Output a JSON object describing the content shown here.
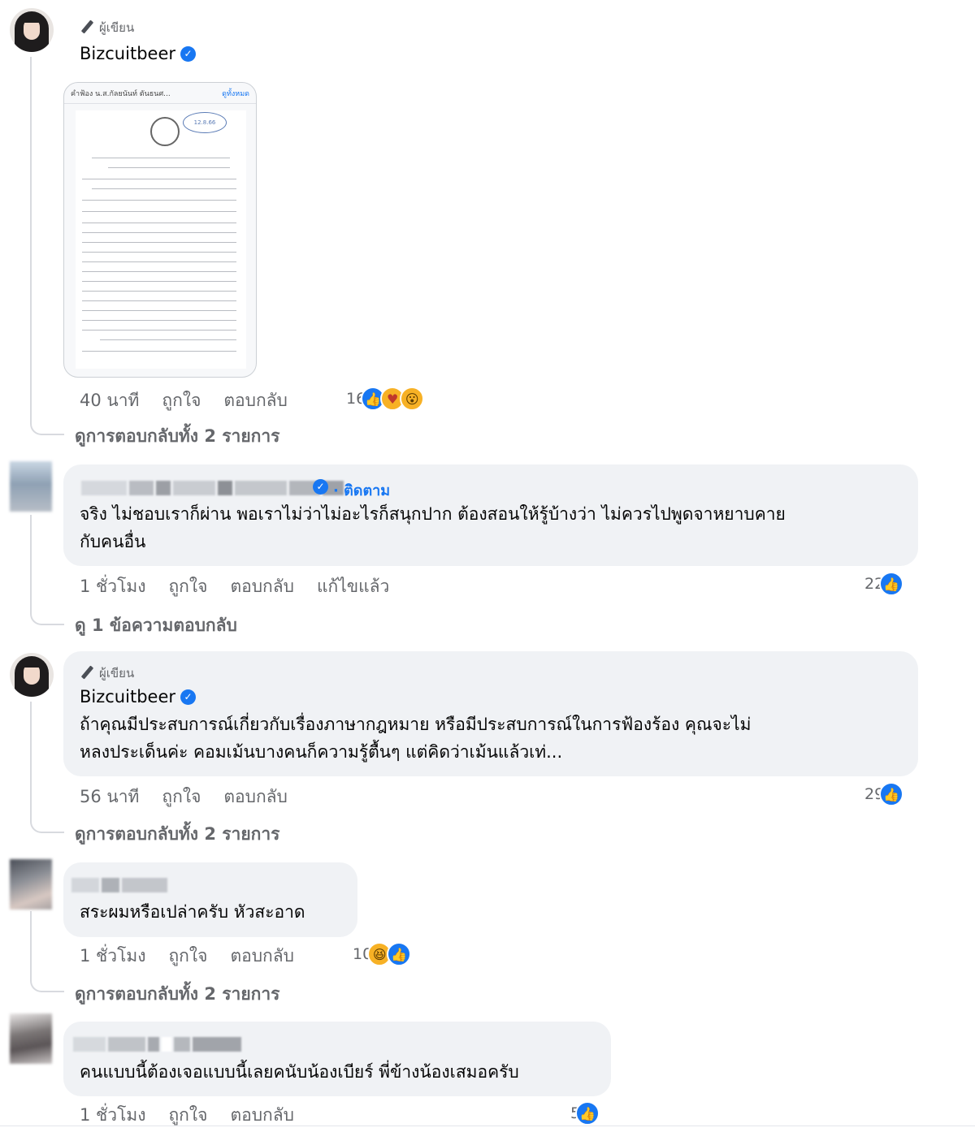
{
  "comments": [
    {
      "badge": "ผู้เขียน",
      "name": "Bizcuitbeer",
      "verified": true,
      "attachment": {
        "header": "คำฟ้อง น.ส.กัลยนันท์ ตันธนศ...",
        "header_action": "ดูทั้งหมด",
        "stamp": "12.8.66"
      },
      "time": "40 นาที",
      "like": "ถูกใจ",
      "reply": "ตอบกลับ",
      "reaction_count": "16",
      "reaction_icons": [
        "like-icon",
        "care-icon",
        "wow-icon"
      ],
      "view_replies": "ดูการตอบกลับทั้ง 2 รายการ"
    },
    {
      "name_blurred": true,
      "verified": true,
      "follow": "· ติดตาม",
      "text_line1": "จริง ไม่ชอบเราก็ผ่าน พอเราไม่ว่าไม่อะไรก็สนุกปาก ต้องสอนให้รู้บ้างว่า ไม่ควรไปพูดจาหยาบคาย",
      "text_line2": "กับคนอื่น",
      "time": "1 ชั่วโมง",
      "like": "ถูกใจ",
      "reply": "ตอบกลับ",
      "edited": "แก้ไขแล้ว",
      "reaction_count": "22",
      "reaction_icons": [
        "like-icon"
      ],
      "view_replies": "ดู 1 ข้อความตอบกลับ"
    },
    {
      "badge": "ผู้เขียน",
      "name": "Bizcuitbeer",
      "verified": true,
      "text_line1": "ถ้าคุณมีประสบการณ์เกี่ยวกับเรื่องภาษากฎหมาย หรือมีประสบการณ์ในการฟ้องร้อง คุณจะไม่",
      "text_line2": "หลงประเด็นค่ะ คอมเม้นบางคนก็ความรู้ตื้นๆ แต่คิดว่าเม้นแล้วเท่...",
      "time": "56 นาที",
      "like": "ถูกใจ",
      "reply": "ตอบกลับ",
      "reaction_count": "29",
      "reaction_icons": [
        "like-icon"
      ],
      "view_replies": "ดูการตอบกลับทั้ง 2 รายการ"
    },
    {
      "name_blurred": true,
      "text_line1": "สระผมหรือเปล่าครับ หัวสะอาด",
      "time": "1 ชั่วโมง",
      "like": "ถูกใจ",
      "reply": "ตอบกลับ",
      "reaction_count": "10",
      "reaction_icons": [
        "haha-icon",
        "like-icon"
      ],
      "view_replies": "ดูการตอบกลับทั้ง 2 รายการ"
    },
    {
      "name_blurred": true,
      "text_line1": "คนแบบนี้ต้องเจอแบบนี้เลยคนับน้องเบียร์ พี่ข้างน้องเสมอครับ",
      "time": "1 ชั่วโมง",
      "like": "ถูกใจ",
      "reply": "ตอบกลับ",
      "reaction_count": "5",
      "reaction_icons": [
        "like-icon"
      ]
    }
  ],
  "colors": {
    "accent": "#1877f2",
    "bubble": "#f0f2f5",
    "meta": "#65676b",
    "text": "#050505"
  }
}
